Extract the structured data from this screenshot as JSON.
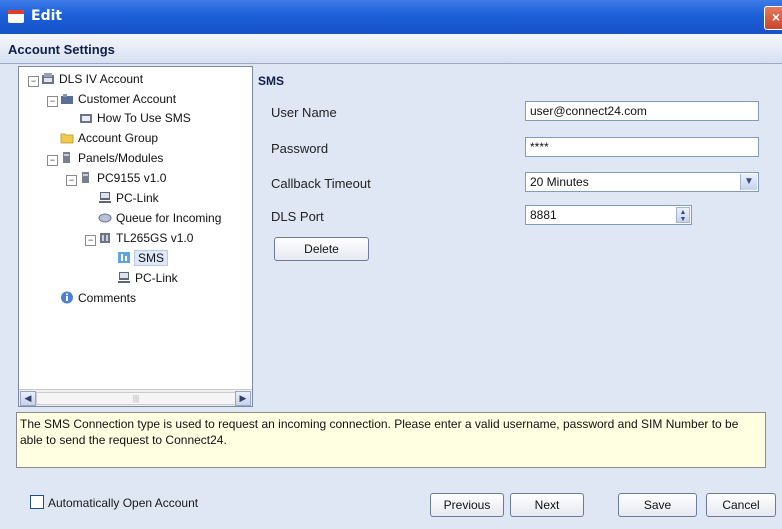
{
  "window": {
    "title": "Edit",
    "close_glyph": "×"
  },
  "header": {
    "title": "Account Settings"
  },
  "tree": {
    "items": [
      {
        "label": "DLS IV Account",
        "icon": "account-icon"
      },
      {
        "label": "Customer Account",
        "icon": "customer-icon"
      },
      {
        "label": "How To Use SMS",
        "icon": "help-doc-icon"
      },
      {
        "label": "Account Group",
        "icon": "folder-icon"
      },
      {
        "label": "Panels/Modules",
        "icon": "panels-icon"
      },
      {
        "label": "PC9155 v1.0",
        "icon": "panel-icon"
      },
      {
        "label": "PC-Link",
        "icon": "pc-link-icon"
      },
      {
        "label": "Queue for Incoming",
        "icon": "queue-icon"
      },
      {
        "label": "TL265GS v1.0",
        "icon": "module-icon"
      },
      {
        "label": "SMS",
        "icon": "sms-icon"
      },
      {
        "label": "PC-Link",
        "icon": "pc-link-icon"
      },
      {
        "label": "Comments",
        "icon": "info-icon"
      }
    ],
    "expander_glyph": "−"
  },
  "form": {
    "section_title": "SMS",
    "fields": {
      "user_name": {
        "label": "User Name",
        "value": "user@connect24.com"
      },
      "password": {
        "label": "Password",
        "value": "****"
      },
      "callback_timeout": {
        "label": "Callback Timeout",
        "value": "20 Minutes"
      },
      "dls_port": {
        "label": "DLS Port",
        "value": "8881"
      }
    },
    "delete_label": "Delete"
  },
  "info_text": "The SMS Connection type is used to request an incoming connection.  Please enter a valid username, password and SIM Number to be able to send the request to Connect24.",
  "footer": {
    "auto_open_label": "Automatically Open Account",
    "auto_open_checked": false,
    "previous_label": "Previous",
    "next_label": "Next",
    "save_label": "Save",
    "cancel_label": "Cancel"
  },
  "colors": {
    "title_bar": "#1c5fd8",
    "background": "#dfe6f4",
    "info_bg": "#ffffe1",
    "close": "#c7472c"
  }
}
